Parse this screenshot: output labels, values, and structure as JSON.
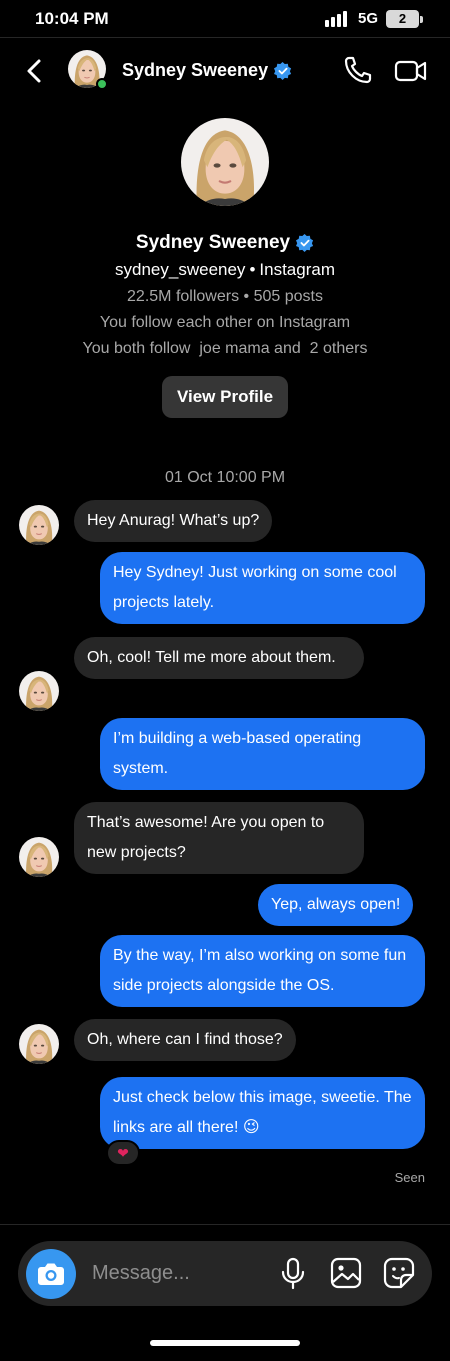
{
  "status_bar": {
    "time": "10:04 PM",
    "network": "5G",
    "battery": "2"
  },
  "contact": {
    "name": "Sydney Sweeney",
    "verified": true,
    "online": true
  },
  "profile": {
    "name": "Sydney Sweeney",
    "handle": "sydney_sweeney",
    "platform": "Instagram",
    "stats": "22.5M followers • 505 posts",
    "mutual_follow": "You follow each other on Instagram",
    "mutual_friends": "You both follow  joe mama and  2 others",
    "view_profile_label": "View Profile"
  },
  "thread": {
    "timestamp": "01 Oct 10:00 PM",
    "messages": [
      {
        "from": "them",
        "text": "Hey Anurag! What’s up?"
      },
      {
        "from": "me",
        "text": "Hey Sydney! Just working on some cool projects lately."
      },
      {
        "from": "them",
        "text": "Oh, cool! Tell me more about them."
      },
      {
        "from": "me",
        "text": "I’m building a web-based operating system."
      },
      {
        "from": "them",
        "text": "That’s awesome! Are you open to new projects?"
      },
      {
        "from": "me",
        "text": "Yep, always open!"
      },
      {
        "from": "me",
        "text": "By the way, I’m also working on some fun side projects alongside the OS."
      },
      {
        "from": "them",
        "text": "Oh, where can I find those?"
      },
      {
        "from": "me",
        "text": "Just check below this image, sweetie. The links are all there! 😉"
      }
    ],
    "reaction": "❤",
    "seen_label": "Seen"
  },
  "composer": {
    "placeholder": "Message..."
  },
  "colors": {
    "outgoing_bubble": "#1d72f2",
    "incoming_bubble": "#262626",
    "camera_button": "#3797f0",
    "verified": "#3897f0",
    "online": "#3bc15a"
  },
  "icons": [
    "back-icon",
    "call-icon",
    "video-icon",
    "verified-icon",
    "camera-icon",
    "mic-icon",
    "gallery-icon",
    "sticker-icon"
  ]
}
